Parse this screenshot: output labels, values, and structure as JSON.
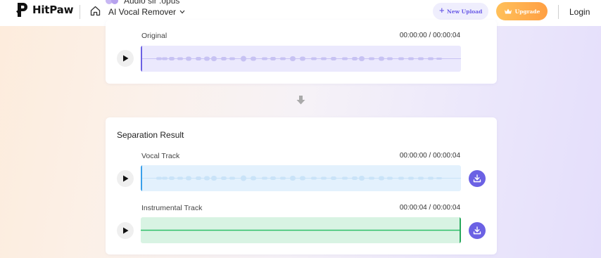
{
  "header": {
    "brand": "HitPaw",
    "tool_name": "AI Vocal Remover",
    "file_name": "Audio sir .opus",
    "new_upload_label": "New Upload",
    "upgrade_label": "Upgrade",
    "login_label": "Login"
  },
  "original": {
    "label": "Original",
    "time": "00:00:00 / 00:00:04",
    "progress": 0.0
  },
  "result": {
    "title": "Separation Result",
    "tracks": [
      {
        "label": "Vocal Track",
        "time": "00:00:00 / 00:00:04",
        "progress": 0.0
      },
      {
        "label": "Instrumental Track",
        "time": "00:00:04 / 00:00:04",
        "progress": 1.0
      }
    ]
  },
  "colors": {
    "accent": "#6b61e4",
    "original_wave_bg": "#ebe9fd",
    "vocal_wave_bg": "#e3f1fd",
    "instrumental_wave_bg": "#d8f3e3",
    "upgrade_start": "#ffc05a",
    "upgrade_end": "#ff9f43"
  }
}
